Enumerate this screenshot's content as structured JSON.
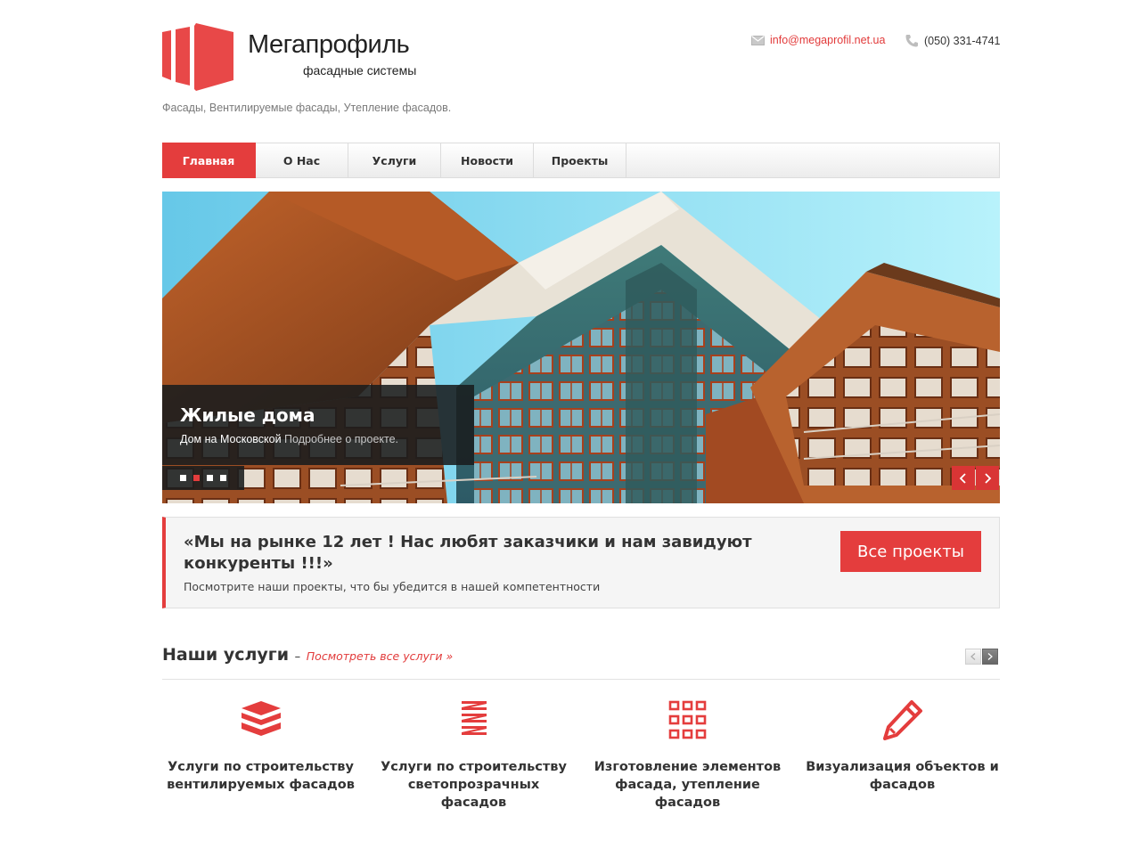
{
  "brand": {
    "name": "Мегапрофиль",
    "subtitle": "фасадные системы",
    "tagline": "Фасады, Вентилируемые фасады, Утепление фасадов."
  },
  "contacts": {
    "email": "info@megaprofil.net.ua",
    "phone": "(050) 331-4741",
    "email_icon": "envelope-icon",
    "phone_icon": "phone-icon"
  },
  "nav": {
    "items": [
      {
        "label": "Главная",
        "active": true
      },
      {
        "label": "О Нас",
        "active": false
      },
      {
        "label": "Услуги",
        "active": false
      },
      {
        "label": "Новости",
        "active": false
      },
      {
        "label": "Проекты",
        "active": false
      }
    ]
  },
  "slider": {
    "title": "Жилые дома",
    "text": "Дом на Московской",
    "link": "Подробнее о проекте.",
    "slide_count": 4,
    "active_slide": 2
  },
  "callout": {
    "title": "«Мы на рынке 12 лет ! Нас любят заказчики и нам завидуют конкуренты !!!»",
    "subtitle": "Посмотрите наши проекты, что бы убедится в нашей компетентности",
    "button": "Все проекты"
  },
  "services": {
    "title": "Наши услуги",
    "separator": "–",
    "link": "Посмотреть все услуги »",
    "items": [
      {
        "title": "Услуги по строительству вентилируемых фасадов",
        "icon": "layers-icon"
      },
      {
        "title": "Услуги по строительству светопрозрачных фасадов",
        "icon": "stack-icon"
      },
      {
        "title": "Изготовление элементов фасада, утепление фасадов",
        "icon": "grid-icon"
      },
      {
        "title": "Визуализация объектов и фасадов",
        "icon": "pencil-icon"
      }
    ]
  },
  "colors": {
    "accent": "#e43d3d",
    "text": "#333333",
    "muted": "#7a7a7a"
  }
}
